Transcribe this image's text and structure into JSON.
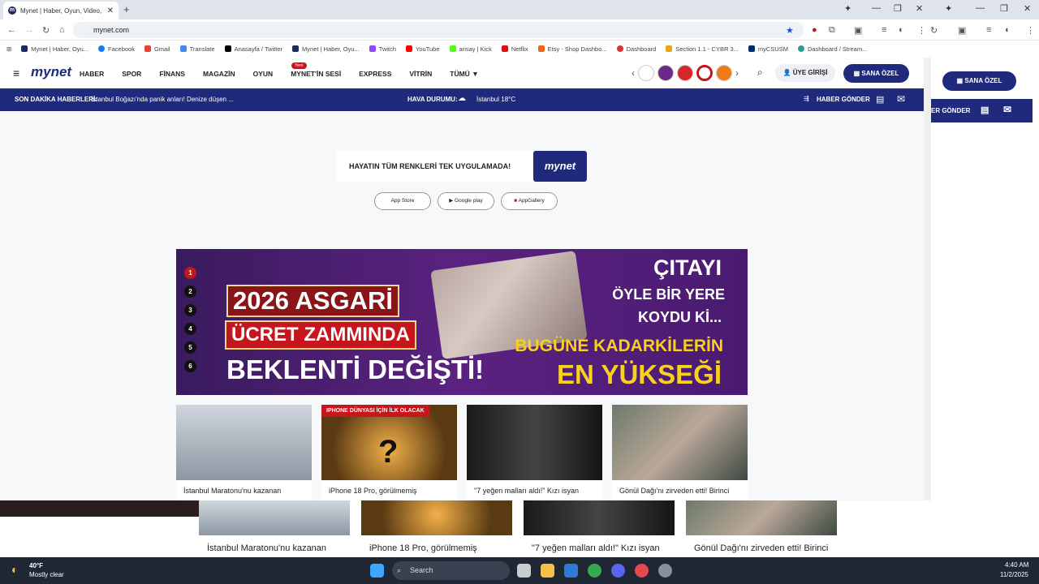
{
  "browser": {
    "tab_title": "Mynet | Haber, Oyun, Video, Sp",
    "url": "mynet.com",
    "bookmarks": [
      "Mynet | Haber, Oyu...",
      "Facebook",
      "Gmail",
      "Translate",
      "Anasayfa / Twitter",
      "Mynet | Haber, Oyu...",
      "Twitch",
      "YouTube",
      "arisay | Kick",
      "Netflix",
      "Etsy - Shop Dashbo...",
      "Dashboard",
      "Section 1.1 - CYBR 3...",
      "myCSUSM",
      "Dashboard / Stream..."
    ]
  },
  "site": {
    "logo": "mynet",
    "menu": [
      "HABER",
      "SPOR",
      "FİNANS",
      "MAGAZİN",
      "OYUN",
      "MYNET'İN SESİ",
      "EXPRESS",
      "VİTRİN",
      "TÜMÜ"
    ],
    "menu_badge": "Yeni",
    "login": "ÜYE GİRİŞİ",
    "personal": "SANA ÖZEL"
  },
  "breaking": {
    "label": "SON DAKİKA HABERLERİ:",
    "text": "İstanbul Boğazı'nda panik anları! Denize düşen ...",
    "weather_label": "HAVA DURUMU:",
    "weather_value": "İstanbul 18°C",
    "send_news": "HABER GÖNDER"
  },
  "promo": {
    "text": "HAYATIN TÜM RENKLERİ TEK UYGULAMADA!",
    "logo": "mynet",
    "stores": [
      "App Store",
      "Google play",
      "AppGallery"
    ]
  },
  "hero": {
    "numbers": [
      "1",
      "2",
      "3",
      "4",
      "5",
      "6"
    ],
    "line1": "2026 ASGARİ",
    "line2": "ÜCRET ZAMMINDA",
    "line3": "BEKLENTİ DEĞİŞTİ!",
    "right1": "ÇITAYI",
    "right2": "ÖYLE BİR YERE",
    "right3": "KOYDU Kİ...",
    "right4": "BUGÜNE KADARKİLERİN",
    "right5": "EN YÜKSEĞİ"
  },
  "cards": [
    {
      "caption": "İstanbul Maratonu'nu kazanan",
      "tag": ""
    },
    {
      "caption": "iPhone 18 Pro, görülmemiş",
      "tag": "IPHONE DÜNYASI İÇİN İLK OLACAK"
    },
    {
      "caption": "\"7 yeğen malları aldı!\" Kızı isyan",
      "tag": ""
    },
    {
      "caption": "Gönül Dağı'nı zirveden etti! Birinci",
      "tag": ""
    }
  ],
  "right_panel": {
    "personal": "SANA ÖZEL",
    "send_news": "ER GÖNDER"
  },
  "taskbar": {
    "weather_temp": "40°F",
    "weather_desc": "Mostly clear",
    "search": "Search",
    "time": "4:40 AM",
    "date": "11/2/2025"
  },
  "colors": {
    "brand": "#1f2a7c",
    "accent": "#c4161c"
  }
}
